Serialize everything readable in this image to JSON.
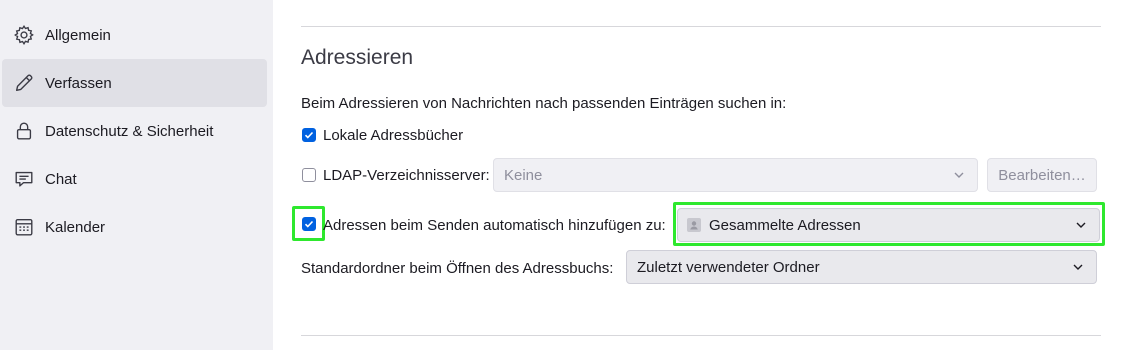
{
  "sidebar": {
    "items": [
      {
        "label": "Allgemein",
        "icon": "gear-icon"
      },
      {
        "label": "Verfassen",
        "icon": "pencil-icon"
      },
      {
        "label": "Datenschutz & Sicherheit",
        "icon": "lock-icon"
      },
      {
        "label": "Chat",
        "icon": "chat-icon"
      },
      {
        "label": "Kalender",
        "icon": "calendar-icon"
      }
    ],
    "selected": "Verfassen"
  },
  "section": {
    "title": "Adressieren",
    "description": "Beim Adressieren von Nachrichten nach passenden Einträgen suchen in:",
    "local_addressbooks": {
      "label": "Lokale Adressbücher",
      "checked": true
    },
    "ldap": {
      "label": "LDAP-Verzeichnisserver:",
      "checked": false,
      "select_value": "Keine",
      "edit_button": "Bearbeiten…"
    },
    "auto_add": {
      "label": "Adressen beim Senden automatisch hinzufügen zu:",
      "checked": true,
      "select_value": "Gesammelte Adressen"
    },
    "default_folder": {
      "label": "Standardordner beim Öffnen des Adressbuchs:",
      "select_value": "Zuletzt verwendeter Ordner"
    }
  },
  "colors": {
    "accent": "#0061e0",
    "highlight": "#2ee82e",
    "sidebar_bg": "#f0f0f4",
    "selected_bg": "#e0e0e6"
  }
}
